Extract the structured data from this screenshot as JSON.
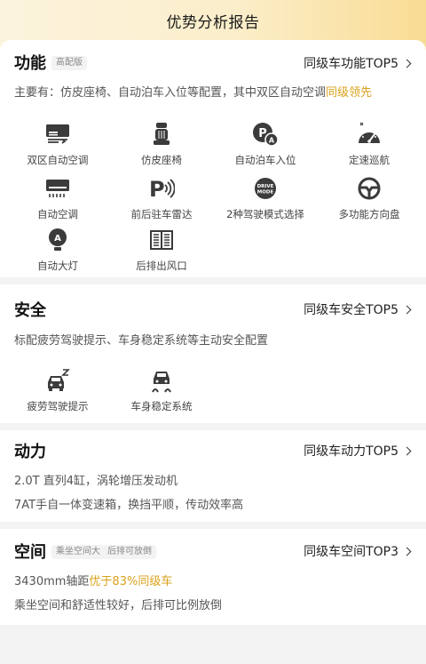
{
  "title": "优势分析报告",
  "sections": {
    "function": {
      "title": "功能",
      "badge": "高配版",
      "top_link": "同级车功能TOP5",
      "desc_main": "主要有：仿皮座椅、自动泊车入位等配置，其中双区自动空调",
      "desc_highlight": "同级领先",
      "items": [
        {
          "label": "双区自动空调",
          "icon": "dual-zone-ac-icon"
        },
        {
          "label": "仿皮座椅",
          "icon": "seat-icon"
        },
        {
          "label": "自动泊车入位",
          "icon": "auto-parking-icon"
        },
        {
          "label": "定速巡航",
          "icon": "cruise-control-icon"
        },
        {
          "label": "自动空调",
          "icon": "auto-ac-icon"
        },
        {
          "label": "前后驻车雷达",
          "icon": "parking-radar-icon"
        },
        {
          "label": "2种驾驶模式选择",
          "icon": "drive-mode-icon"
        },
        {
          "label": "多功能方向盘",
          "icon": "steering-wheel-icon"
        },
        {
          "label": "自动大灯",
          "icon": "auto-headlight-icon"
        },
        {
          "label": "后排出风口",
          "icon": "rear-vent-icon"
        }
      ]
    },
    "safety": {
      "title": "安全",
      "top_link": "同级车安全TOP5",
      "desc": "标配疲劳驾驶提示、车身稳定系统等主动安全配置",
      "items": [
        {
          "label": "疲劳驾驶提示",
          "icon": "fatigue-alert-icon"
        },
        {
          "label": "车身稳定系统",
          "icon": "stability-control-icon"
        }
      ]
    },
    "power": {
      "title": "动力",
      "top_link": "同级车动力TOP5",
      "line1": "2.0T 直列4缸，涡轮增压发动机",
      "line2": "7AT手自一体变速箱，换挡平顺，传动效率高"
    },
    "space": {
      "title": "空间",
      "badges": [
        "乘坐空间大",
        "后排可放倒"
      ],
      "top_link": "同级车空间TOP3",
      "line1_main": "3430mm轴距",
      "line1_highlight": "优于83%同级车",
      "line2": "乘坐空间和舒适性较好，后排可比例放倒"
    }
  },
  "colors": {
    "highlight": "#d9a21b",
    "header_gradient_end": "#f9dc94"
  }
}
